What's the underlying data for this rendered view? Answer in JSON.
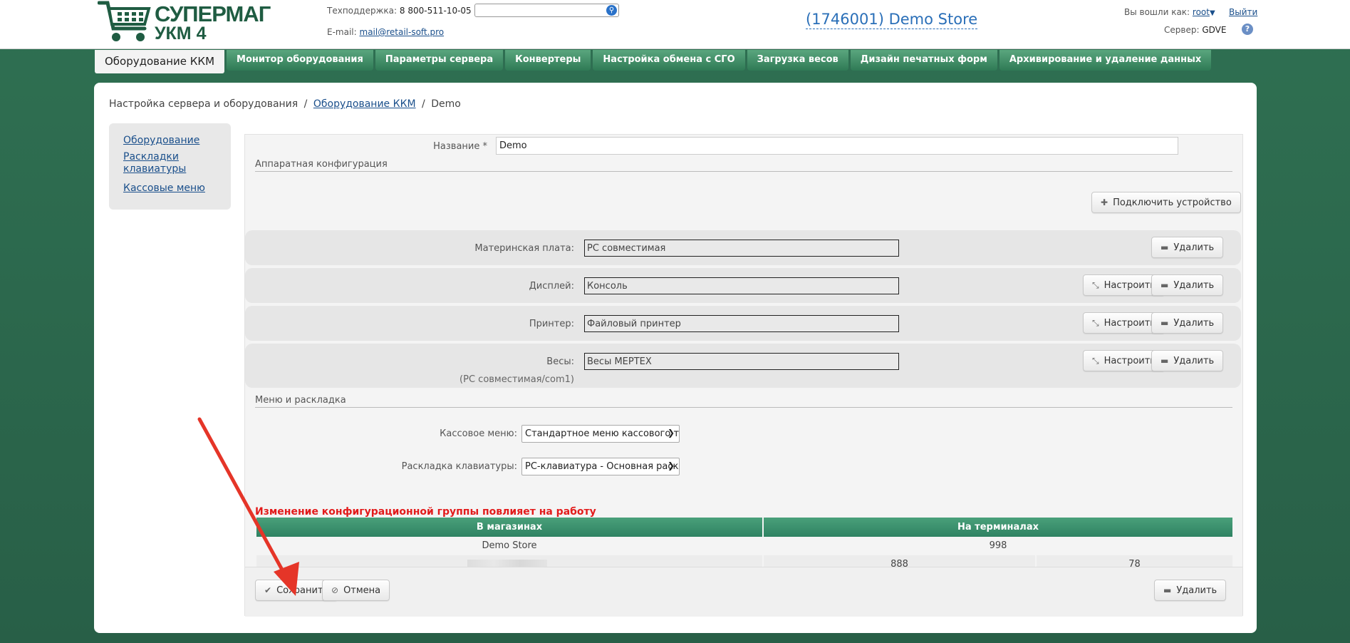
{
  "header": {
    "logo_line1": "СУПЕРМАГ",
    "logo_line2": "УКМ 4",
    "support_label": "Техподдержка:",
    "support_phone": "8 800-511-10-05",
    "email_label": "E-mail:",
    "email_value": "mail@retail-soft.pro",
    "search_placeholder": "",
    "store_title": "(1746001) Demo Store",
    "logged_in_label": "Вы вошли как:",
    "user": "root",
    "logout": "Выйти",
    "server_label": "Сервер:",
    "server_value": "GDVE",
    "help": "?"
  },
  "tabs": [
    {
      "label": "Оборудование ККМ",
      "active": true
    },
    {
      "label": "Монитор оборудования"
    },
    {
      "label": "Параметры сервера"
    },
    {
      "label": "Конвертеры"
    },
    {
      "label": "Настройка обмена с СГО"
    },
    {
      "label": "Загрузка весов"
    },
    {
      "label": "Дизайн печатных форм"
    },
    {
      "label": "Архивирование и удаление данных"
    }
  ],
  "breadcrumb": {
    "root": "Настройка сервера и оборудования",
    "sep": "/",
    "link": "Оборудование ККМ",
    "current": "Demo"
  },
  "sidebar": {
    "items": [
      "Оборудование",
      "Раскладки клавиатуры",
      "Кассовые меню"
    ]
  },
  "form": {
    "name_label": "Название *",
    "name_value": "Demo",
    "hardware_section": "Аппаратная конфигурация",
    "connect_button": "Подключить устройство",
    "devices": [
      {
        "label": "Материнская плата:",
        "value": "PC совместимая",
        "configurable": false
      },
      {
        "label": "Дисплей:",
        "value": "Консоль",
        "configurable": true
      },
      {
        "label": "Принтер:",
        "value": "Файловый принтер",
        "configurable": true
      },
      {
        "label": "Весы:",
        "value": "Весы МЕРТЕХ",
        "configurable": true,
        "sublabel": "(PC совместимая/com1)"
      }
    ],
    "configure_label": "Настроить",
    "delete_label": "Удалить",
    "menu_section": "Меню и раскладка",
    "cash_menu_label": "Кассовое меню:",
    "cash_menu_value": "Стандартное меню кассового термин",
    "keyboard_label": "Раскладка клавиатуры:",
    "keyboard_value": "PC-клавиатура - Основная раскладка",
    "warning": "Изменение конфигурационной группы повлияет на работу",
    "table": {
      "headers": [
        "В магазинах",
        "На терминалах"
      ],
      "rows": [
        {
          "store": "Demo Store",
          "terminals": "998"
        },
        {
          "store": "",
          "term1": "888",
          "term2": "78"
        }
      ]
    },
    "save_button": "Сохранить",
    "cancel_button": "Отмена",
    "delete_button": "Удалить"
  },
  "colors": {
    "background": "#2d6b4f",
    "tab": "#3a8a62",
    "warning": "#e21b1b",
    "link": "#1a4f8b",
    "arrow": "#e53528"
  }
}
